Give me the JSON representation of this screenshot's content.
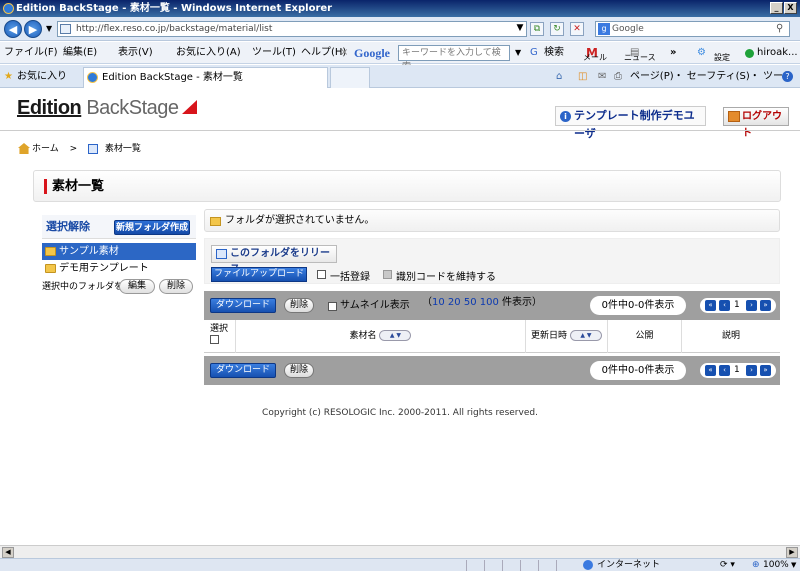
{
  "window": {
    "title": "Edition BackStage - 素材一覧 - Windows Internet Explorer",
    "minimize_glyph": "_",
    "close_glyph": "X"
  },
  "addressbar": {
    "url": "http://flex.reso.co.jp/backstage/material/list",
    "search_placeholder": "Google"
  },
  "menubar": {
    "items": [
      "ファイル(F)",
      "編集(E)",
      "表示(V)",
      "お気に入り(A)",
      "ツール(T)",
      "ヘルプ(H)"
    ],
    "google_label": "Google",
    "google_placeholder": "キーワードを入力して検索",
    "search_label": "検索",
    "mail_label": "メール",
    "news_label": "ニュース",
    "settings_label": "設定",
    "user_label": "hiroak..."
  },
  "favbar": {
    "favorites_label": "お気に入り",
    "tab_label": "Edition BackStage - 素材一覧",
    "commands": "ページ(P)・ セーフティ(S)・ ツール(O)・"
  },
  "header": {
    "logo_bold": "Edition",
    "logo_rest": " BackStage",
    "user_button": "テンプレート制作デモユーザ",
    "logout_button": "ログアウト"
  },
  "breadcrumb": {
    "home": "ホーム",
    "separator": ">",
    "current": "素材一覧"
  },
  "page_title": "素材一覧",
  "sidebar": {
    "clear_selection": "選択解除",
    "new_folder_button": "新規フォルダ作成",
    "folders": [
      "サンプル素材",
      "デモ用テンプレート"
    ],
    "selected_folder_label": "選択中のフォルダを",
    "edit_button": "編集",
    "delete_button": "削除"
  },
  "main": {
    "no_folder_message": "フォルダが選択されていません。",
    "release_button": "このフォルダをリリース",
    "upload_button": "ファイルアップロード",
    "bulk_register_label": "一括登録",
    "keep_id_label": "識別コードを維持する"
  },
  "table": {
    "download_button": "ダウンロード",
    "delete_button": "削除",
    "thumbnail_label": "サムネイル表示",
    "page_sizes_prefix": "（",
    "page_sizes": [
      "10",
      "20",
      "50",
      "100"
    ],
    "page_sizes_suffix": "件表示）",
    "page_info": "0件中0-0件表示",
    "current_page": "1",
    "columns": [
      "選択",
      "素材名",
      "更新日時",
      "公開",
      "説明"
    ],
    "sort_glyph": "▲ ▼"
  },
  "footer": {
    "copyright": "Copyright (c) RESOLOGIC Inc. 2000-2011. All rights reserved."
  },
  "statusbar": {
    "zone": "インターネット",
    "zoom": "100%"
  }
}
